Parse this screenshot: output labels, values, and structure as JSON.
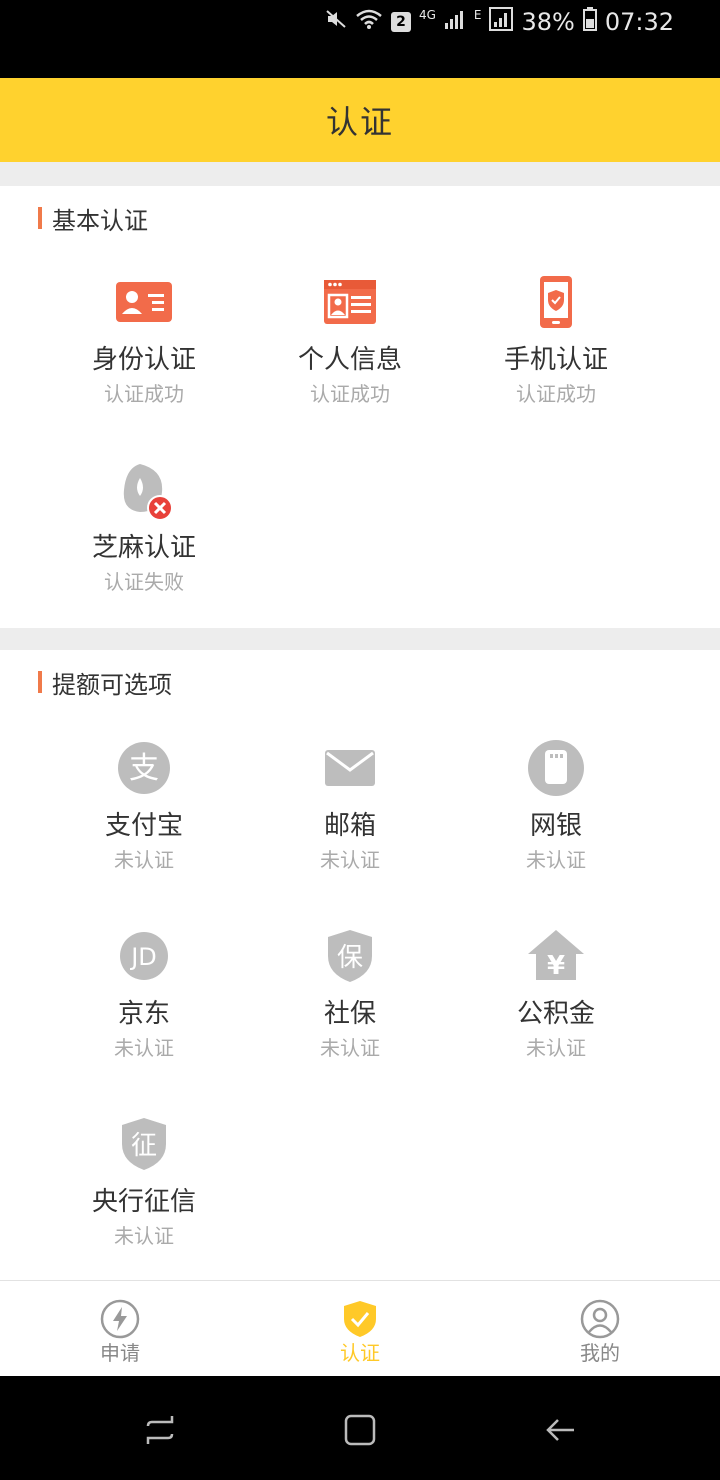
{
  "status_bar": {
    "sim_badge": "2",
    "network_4g": "4G",
    "network_e": "E",
    "battery": "38%",
    "time": "07:32"
  },
  "header": {
    "title": "认证"
  },
  "basic_section": {
    "title": "基本认证",
    "items": [
      {
        "name": "身份认证",
        "status": "认证成功",
        "icon": "id-card-icon"
      },
      {
        "name": "个人信息",
        "status": "认证成功",
        "icon": "personal-info-icon"
      },
      {
        "name": "手机认证",
        "status": "认证成功",
        "icon": "phone-shield-icon"
      },
      {
        "name": "芝麻认证",
        "status": "认证失败",
        "icon": "sesame-icon"
      }
    ]
  },
  "optional_section": {
    "title": "提额可选项",
    "items": [
      {
        "name": "支付宝",
        "status": "未认证",
        "icon": "alipay-icon",
        "glyph": "支"
      },
      {
        "name": "邮箱",
        "status": "未认证",
        "icon": "mail-icon"
      },
      {
        "name": "网银",
        "status": "未认证",
        "icon": "bank-card-icon"
      },
      {
        "name": "京东",
        "status": "未认证",
        "icon": "jd-icon",
        "glyph": "JD"
      },
      {
        "name": "社保",
        "status": "未认证",
        "icon": "social-security-icon",
        "glyph": "保"
      },
      {
        "name": "公积金",
        "status": "未认证",
        "icon": "housing-fund-icon",
        "glyph": "¥"
      },
      {
        "name": "央行征信",
        "status": "未认证",
        "icon": "credit-report-icon",
        "glyph": "征"
      }
    ]
  },
  "bottom_nav": {
    "items": [
      {
        "label": "申请",
        "icon": "lightning-icon"
      },
      {
        "label": "认证",
        "icon": "shield-check-icon"
      },
      {
        "label": "我的",
        "icon": "user-icon"
      }
    ],
    "active_color": "#FFC928"
  },
  "colors": {
    "header_bg": "#FFD22E",
    "accent_orange": "#F26B4A",
    "section_bar": "#F07A4A",
    "icon_grey": "#BDBDBD",
    "error_red": "#E8413A"
  }
}
